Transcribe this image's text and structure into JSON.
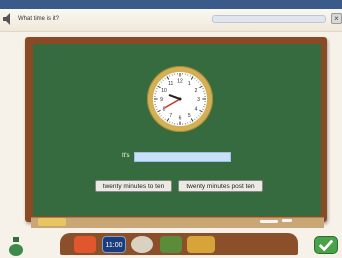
{
  "header": {
    "title": "What time is it?"
  },
  "board": {
    "prompt_label": "It's",
    "answer_value": "",
    "options": [
      "twenty minutes to ten",
      "twenty minutes post ten"
    ]
  },
  "clock": {
    "hour": 9,
    "minute": 40,
    "numbers": [
      "12",
      "1",
      "2",
      "3",
      "4",
      "5",
      "6",
      "7",
      "8",
      "9",
      "10",
      "11"
    ]
  },
  "toolbar": {
    "digital_clock_label": "11:00"
  },
  "colors": {
    "board": "#356b3e",
    "frame": "#8a4a25",
    "answer_bg": "#c8e0f8",
    "accent": "#4aa14a"
  }
}
